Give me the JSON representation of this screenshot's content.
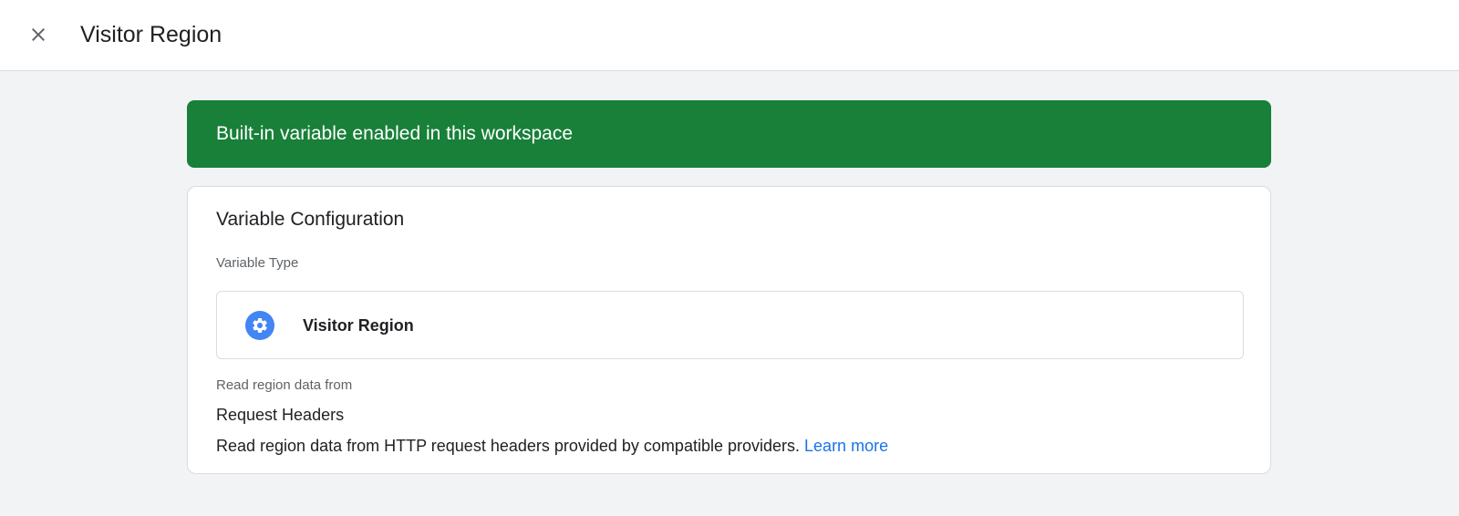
{
  "header": {
    "close_icon": "close-icon",
    "title": "Visitor Region"
  },
  "banner": {
    "text": "Built-in variable enabled in this workspace",
    "color": "#188038"
  },
  "config": {
    "title": "Variable Configuration",
    "variable_type_label": "Variable Type",
    "variable_type": {
      "icon": "gear-icon",
      "icon_color": "#4285f4",
      "name": "Visitor Region"
    },
    "read_from_label": "Read region data from",
    "read_from_value": "Request Headers",
    "description": "Read region data from HTTP request headers provided by compatible providers.",
    "learn_more_label": "Learn more",
    "link_color": "#1a73e8"
  }
}
